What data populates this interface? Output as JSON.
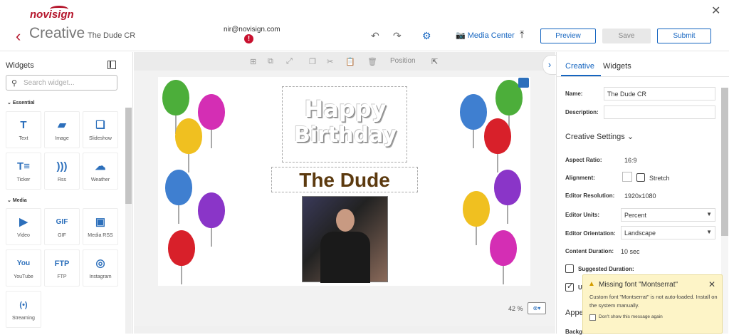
{
  "header": {
    "logo_text": "novisign",
    "title": "Creative",
    "subtitle": "The Dude CR",
    "user_email": "nir@novisign.com",
    "media_center_label": "Media Center",
    "preview_label": "Preview",
    "save_label": "Save",
    "submit_label": "Submit",
    "error_badge": "!"
  },
  "widgets_panel": {
    "title": "Widgets",
    "search_placeholder": "Search widget...",
    "sections": [
      {
        "label": "Essential",
        "items": [
          {
            "label": "Text",
            "icon": "text-icon",
            "glyph": "T"
          },
          {
            "label": "Image",
            "icon": "image-icon",
            "glyph": "▰"
          },
          {
            "label": "Slideshow",
            "icon": "slideshow-icon",
            "glyph": "❏"
          },
          {
            "label": "Ticker",
            "icon": "ticker-icon",
            "glyph": "T≡"
          },
          {
            "label": "Rss",
            "icon": "rss-icon",
            "glyph": ")))"
          },
          {
            "label": "Weather",
            "icon": "weather-icon",
            "glyph": "☁"
          }
        ]
      },
      {
        "label": "Media",
        "items": [
          {
            "label": "Video",
            "icon": "video-icon",
            "glyph": "▶"
          },
          {
            "label": "GIF",
            "icon": "gif-icon",
            "glyph": "GIF"
          },
          {
            "label": "Media RSS",
            "icon": "media-rss-icon",
            "glyph": "▣"
          },
          {
            "label": "YouTube",
            "icon": "youtube-icon",
            "glyph": "You"
          },
          {
            "label": "FTP",
            "icon": "ftp-icon",
            "glyph": "FTP"
          },
          {
            "label": "Instagram",
            "icon": "instagram-icon",
            "glyph": "◎"
          },
          {
            "label": "Streaming",
            "icon": "streaming-icon",
            "glyph": "(•)"
          }
        ]
      }
    ]
  },
  "canvas": {
    "position_label": "Position",
    "happy_text": "Happy",
    "birthday_text": "Birthday",
    "name_text": "The Dude",
    "zoom_label": "42 %"
  },
  "properties": {
    "tabs": [
      "Creative",
      "Widgets"
    ],
    "name_label": "Name:",
    "name_value": "The Dude CR",
    "description_label": "Description:",
    "description_value": "",
    "settings_header": "Creative Settings ⌄",
    "aspect_ratio_label": "Aspect Ratio:",
    "aspect_ratio_value": "16:9",
    "alignment_label": "Alignment:",
    "stretch_label": "Stretch",
    "resolution_label": "Editor Resolution:",
    "resolution_value": "1920x1080",
    "units_label": "Editor Units:",
    "units_value": "Percent",
    "orientation_label": "Editor Orientation:",
    "orientation_value": "Landscape",
    "content_duration_label": "Content Duration:",
    "content_duration_value": "10 sec",
    "suggested_duration_label": "Suggested Duration:",
    "partial_label_1": "Up",
    "partial_label_2": "Appe",
    "partial_label_3": "Background"
  },
  "toast": {
    "title": "Missing font \"Montserrat\"",
    "body": "Custom font \"Montserrat\" is not auto-loaded. Install on the system manually.",
    "checkbox_label": "Don't show this message again"
  },
  "colors": {
    "brand": "#b5162c",
    "accent": "#1565c0",
    "name_text": "#5c3a0f",
    "toast_bg": "#fdf4c7"
  }
}
